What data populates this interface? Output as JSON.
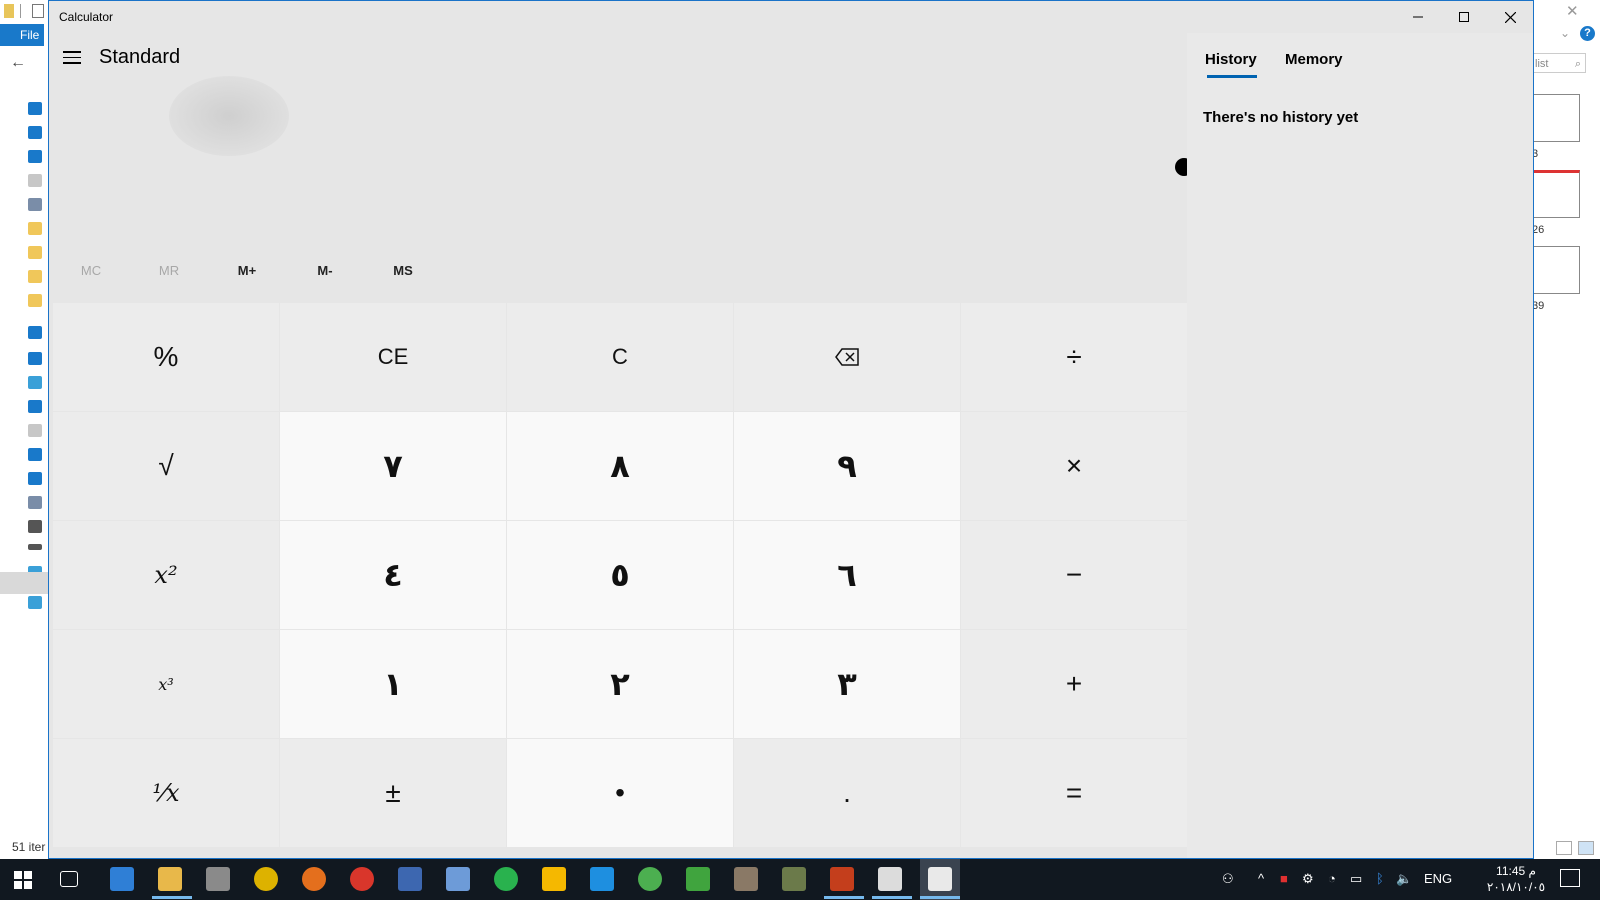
{
  "explorer": {
    "file_tab": "File",
    "status_text": "51 iter",
    "search_placeholder": "list",
    "thumb_numbers": [
      "3",
      "26",
      "39"
    ]
  },
  "calculator": {
    "title": "Calculator",
    "mode": "Standard",
    "memory_buttons": [
      {
        "label": "MC",
        "enabled": false
      },
      {
        "label": "MR",
        "enabled": false
      },
      {
        "label": "M+",
        "enabled": true
      },
      {
        "label": "M-",
        "enabled": true
      },
      {
        "label": "MS",
        "enabled": true
      }
    ],
    "keys": [
      [
        "%",
        "CE",
        "C",
        "backspace",
        "÷"
      ],
      [
        "√",
        "٧",
        "٨",
        "٩",
        "×"
      ],
      [
        "x²",
        "٤",
        "٥",
        "٦",
        "−"
      ],
      [
        "x³",
        "١",
        "٢",
        "٣",
        "+"
      ],
      [
        "¹⁄x",
        "±",
        "•",
        ".",
        "="
      ]
    ],
    "side_panel": {
      "tabs": [
        "History",
        "Memory"
      ],
      "active_tab": "History",
      "empty_message": "There's no history yet"
    }
  },
  "taskbar": {
    "language": "ENG",
    "time": "11:45 م",
    "date": "٢٠١٨/١٠/٠٥",
    "accent": "#76b9ed"
  }
}
